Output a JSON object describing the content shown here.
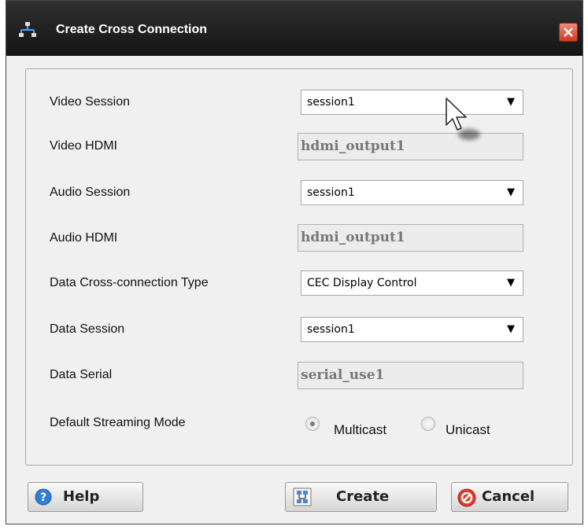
{
  "window": {
    "title": "Create Cross Connection",
    "title_bar_color": "#1c1c1c",
    "close_color": "#d9432c"
  },
  "form": {
    "video_session": {
      "label": "Video Session",
      "value": "session1"
    },
    "video_hdmi": {
      "label": "Video HDMI",
      "value": "hdmi_output1"
    },
    "audio_session": {
      "label": "Audio Session",
      "value": "session1"
    },
    "audio_hdmi": {
      "label": "Audio HDMI",
      "value": "hdmi_output1"
    },
    "data_type": {
      "label": "Data Cross-connection Type",
      "value": "CEC Display Control"
    },
    "data_session": {
      "label": "Data Session",
      "value": "session1"
    },
    "data_serial": {
      "label": "Data Serial",
      "value": "serial_use1"
    },
    "streaming_mode": {
      "label": "Default Streaming Mode",
      "options": [
        "Multicast",
        "Unicast"
      ],
      "selected": "Multicast"
    }
  },
  "buttons": {
    "help": "Help",
    "create": "Create",
    "cancel": "Cancel"
  },
  "icons": {
    "app": "network-icon",
    "close": "close-icon",
    "help": "help-icon",
    "create": "network-icon",
    "cancel": "cancel-icon",
    "dropdown": "dropdown-arrow-icon",
    "cursor": "mouse-pointer-icon"
  }
}
